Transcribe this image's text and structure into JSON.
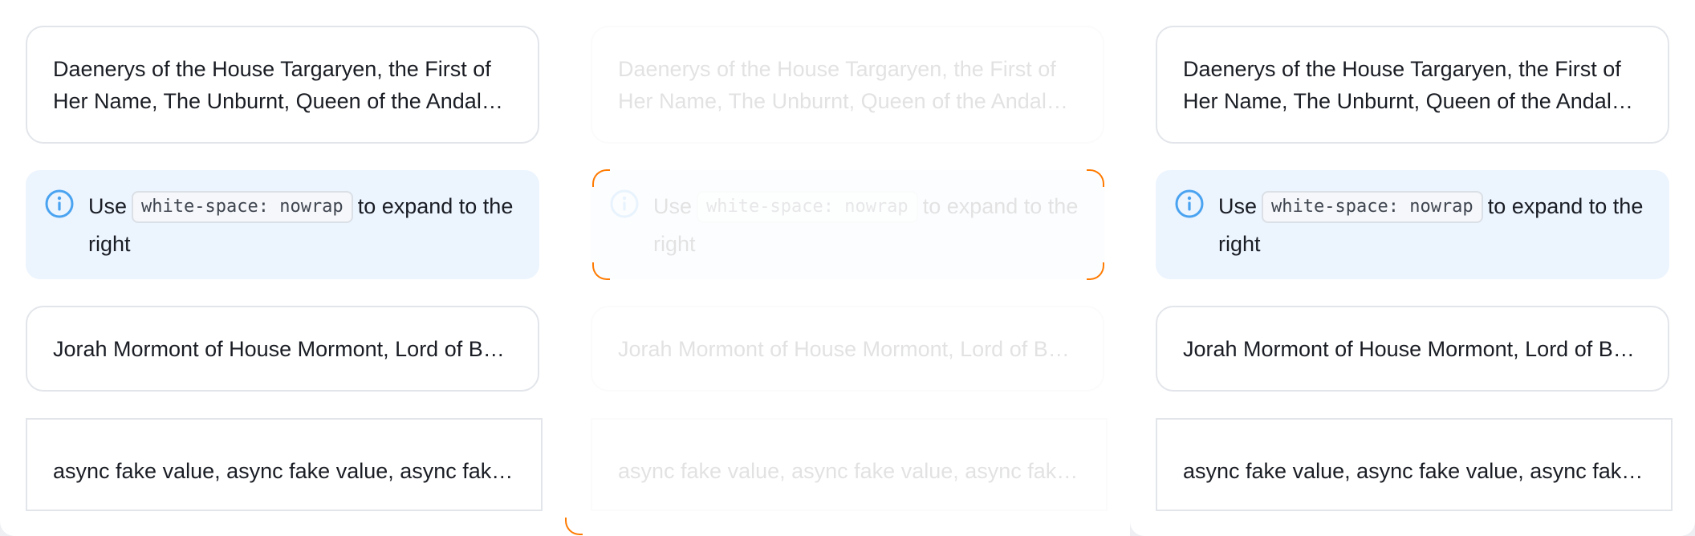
{
  "panels": [
    {
      "label": "left",
      "fullname": "Daenerys of the House Targaryen, the First of Her Name, The Unburnt, Queen of the Andals and the First Men, Khaleesi of the Great Grass Sea, Breaker of Chains, and Mother of Dragons",
      "info": {
        "prefix": "Use",
        "code": "white-space: nowrap",
        "suffix": "to expand to the right"
      },
      "short_name": "Jorah Mormont of House Mormont, Lord of Bear Island",
      "async_value": "async fake value, async fake value, async fake value, async fake value"
    },
    {
      "label": "middle",
      "fullname": "Daenerys of the House Targaryen, the First of Her Name, The Unburnt, Queen of the Andals and the First Men, Khaleesi of the Great Grass Sea, Breaker of Chains, and Mother of Dragons",
      "info": {
        "prefix": "Use",
        "code": "white-space: nowrap",
        "suffix": "to expand to the right"
      },
      "short_name": "Jorah Mormont of House Mormont, Lord of Bear Island",
      "async_value": "async fake value, async fake value, async fake value, async fake value"
    },
    {
      "label": "right",
      "fullname": "Daenerys of the House Targaryen, the First of Her Name, The Unburnt, Queen of the Andals and the First Men, Khaleesi of the Great Grass Sea, Breaker of Chains, and Mother of Dragons",
      "info": {
        "prefix": "Use",
        "code": "white-space: nowrap",
        "suffix": "to expand to the right"
      },
      "short_name": "Jorah Mormont of House Mormont, Lord of Bear Island",
      "async_value": "async fake value, async fake value, async fake value, async fake value"
    }
  ],
  "icons": {
    "info": "info-circle-icon"
  },
  "colors": {
    "info_background": "#ecf4fe",
    "info_icon": "#4aa3f0",
    "text": "#1a1d24",
    "border": "#e2e5ea",
    "corner_artifact": "#ff7a00"
  }
}
